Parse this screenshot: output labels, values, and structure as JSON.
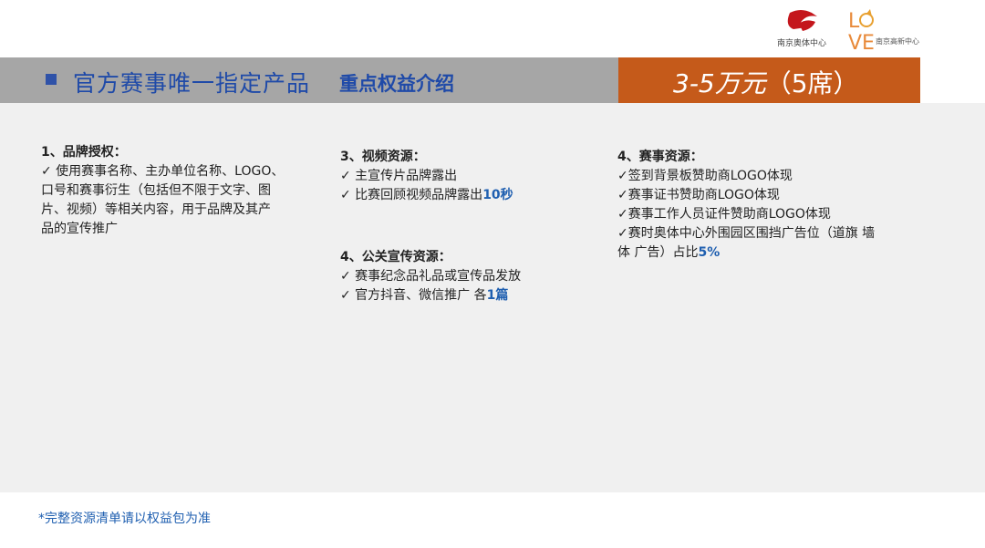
{
  "logos": {
    "org_text": "南京奥体中心",
    "love_text": "L VE",
    "brand_sub": "南京高新中心"
  },
  "header": {
    "title": "官方赛事唯一指定产品",
    "subtitle": "重点权益介绍",
    "price": "3-5万元",
    "seats": "（5席）"
  },
  "sections": {
    "brand": {
      "heading": "1、品牌授权：",
      "items": [
        "✓  使用赛事名称、主办单位名称、LOGO、",
        "口号和赛事衍生（包括但不限于文字、图",
        "片、视频）等相关内容，用于品牌及其产",
        "品的宣传推广"
      ]
    },
    "video": {
      "heading": "3、视频资源：",
      "item1": "✓  主宣传片品牌露出",
      "item2_prefix": "✓  比赛回顾视频品牌露出",
      "item2_highlight": "10秒"
    },
    "pr": {
      "heading": "4、公关宣传资源：",
      "item1": "✓    赛事纪念品礼品或宣传品发放",
      "item2_prefix": "✓    官方抖音、微信推广 各",
      "item2_highlight": "1篇"
    },
    "event": {
      "heading": "4、赛事资源：",
      "item1": "✓签到背景板赞助商LOGO体现",
      "item2": "✓赛事证书赞助商LOGO体现",
      "item3": "✓赛事工作人员证件赞助商LOGO体现",
      "item4_a": "✓赛时奥体中心外围园区围挡广告位（道旗 墙",
      "item4_b_prefix": "体   广告）占比",
      "item4_b_highlight": "5%"
    }
  },
  "footnote": "*完整资源清单请以权益包为准",
  "colors": {
    "accent_blue": "#1f4aa8",
    "price_orange": "#c55a1a",
    "header_gray": "#a6a6a6",
    "panel_gray": "#f0f0f0"
  }
}
